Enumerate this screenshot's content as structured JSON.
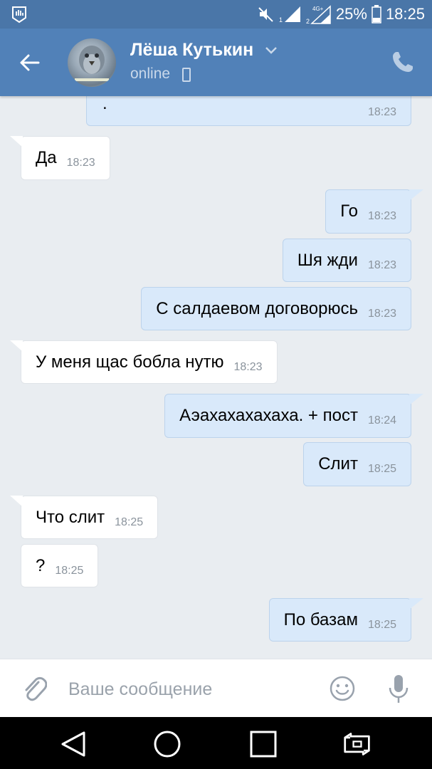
{
  "status_bar": {
    "battery": "25%",
    "time": "18:25",
    "network_label": "4G+",
    "sim1": "1",
    "sim2": "2",
    "icons": [
      "notification-hand-icon",
      "muted-icon",
      "signal-icon",
      "signal-4g-icon",
      "battery-icon"
    ]
  },
  "header": {
    "name": "Лёша Кутькин",
    "status": "online",
    "icons": [
      "back-arrow-icon",
      "chevron-down-icon",
      "mobile-icon",
      "phone-icon"
    ]
  },
  "messages": [
    {
      "dir": "out",
      "text": ".",
      "time": "18:23"
    },
    {
      "dir": "in",
      "text": "Да",
      "time": "18:23"
    },
    {
      "dir": "out",
      "text": "Го",
      "time": "18:23"
    },
    {
      "dir": "out",
      "text": "Шя жди",
      "time": "18:23"
    },
    {
      "dir": "out",
      "text": "С салдаевом договорюсь",
      "time": "18:23"
    },
    {
      "dir": "in",
      "text": "У меня щас бобла нутю",
      "time": "18:23"
    },
    {
      "dir": "out",
      "text": "Аэахахахахаха. + пост",
      "time": "18:24"
    },
    {
      "dir": "out",
      "text": "Слит",
      "time": "18:25"
    },
    {
      "dir": "in",
      "text": "Что слит",
      "time": "18:25"
    },
    {
      "dir": "in",
      "text": "?",
      "time": "18:25"
    },
    {
      "dir": "out",
      "text": "По базам",
      "time": "18:25"
    }
  ],
  "composer": {
    "placeholder": "Ваше сообщение",
    "icons": [
      "paperclip-icon",
      "emoji-icon",
      "microphone-icon"
    ]
  },
  "nav_bar": {
    "icons": [
      "back-triangle-icon",
      "home-circle-icon",
      "recents-square-icon",
      "screen-rotate-icon"
    ]
  },
  "colors": {
    "status_bar": "#4a76a8",
    "header": "#5181b8",
    "background": "#e9edf1",
    "outgoing_bubble": "#d9e9fa",
    "incoming_bubble": "#ffffff"
  }
}
